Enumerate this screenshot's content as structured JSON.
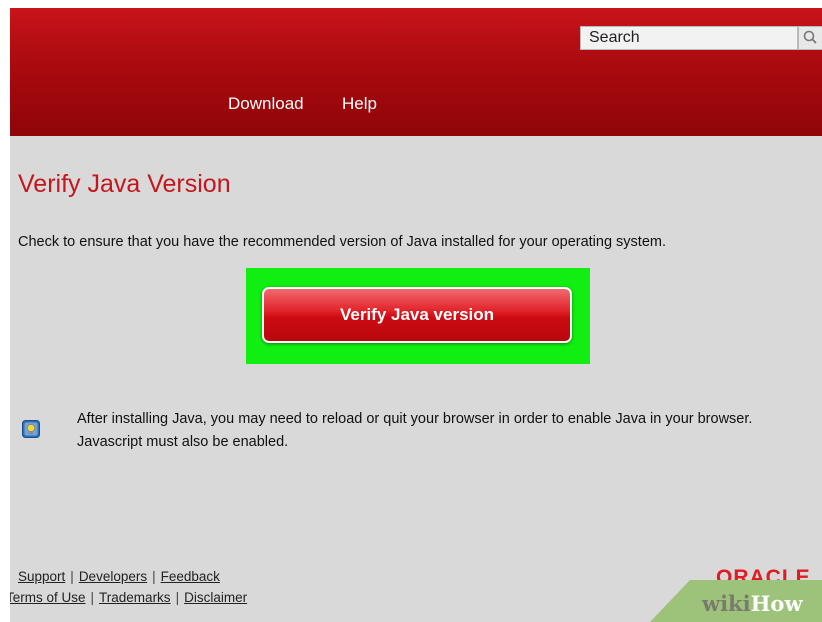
{
  "header": {
    "search_placeholder": "Search",
    "nav": {
      "download": "Download",
      "help": "Help"
    }
  },
  "main": {
    "title": "Verify Java Version",
    "intro": "Check to ensure that you have the recommended version of Java installed for your operating system.",
    "verify_button": "Verify Java version",
    "note": "After installing Java, you may need to reload or quit your browser in order to enable Java in your browser. Javascript must also be enabled."
  },
  "footer": {
    "links_row1": [
      "Support",
      "Developers",
      "Feedback"
    ],
    "links_row2": [
      "Terms of Use",
      "Trademarks",
      "Disclaimer"
    ],
    "oracle_logo": "ORACLE"
  },
  "watermark": {
    "wiki": "wiki",
    "how": "How"
  },
  "colors": {
    "header_red": "#a90a0f",
    "title_red": "#c4161c",
    "highlight_green": "#11ee11",
    "button_red": "#cc0b12"
  }
}
